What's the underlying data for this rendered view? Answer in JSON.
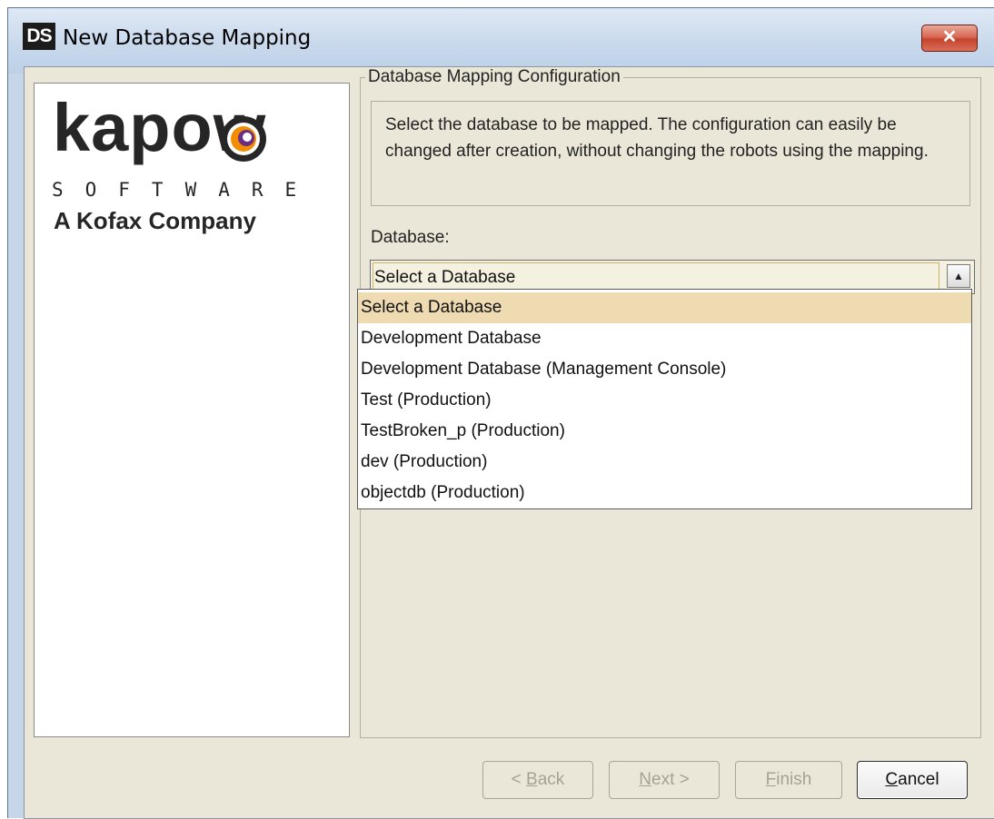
{
  "window": {
    "icon_letters": "DS",
    "title": "New Database Mapping",
    "close_label": "✕"
  },
  "logo": {
    "word": "kapow",
    "software": "SOFTWARE",
    "tagline": "A Kofax Company"
  },
  "config": {
    "group_title": "Database Mapping Configuration",
    "description": "Select the database to be mapped. The configuration can easily be changed after creation, without changing the robots using the mapping.",
    "database_label": "Database:",
    "selected_database": "Select a Database"
  },
  "dropdown": {
    "options": [
      "Select a Database",
      "Development Database",
      "Development Database (Management Console)",
      "Test (Production)",
      "TestBroken_p (Production)",
      "dev (Production)",
      "objectdb (Production)"
    ]
  },
  "buttons": {
    "back": {
      "prefix": "< ",
      "mnemonic": "B",
      "rest": "ack"
    },
    "next": {
      "prefix": "",
      "mnemonic": "N",
      "rest": "ext >"
    },
    "finish": {
      "prefix": "",
      "mnemonic": "F",
      "rest": "inish"
    },
    "cancel": {
      "prefix": "",
      "mnemonic": "C",
      "rest": "ancel"
    }
  }
}
